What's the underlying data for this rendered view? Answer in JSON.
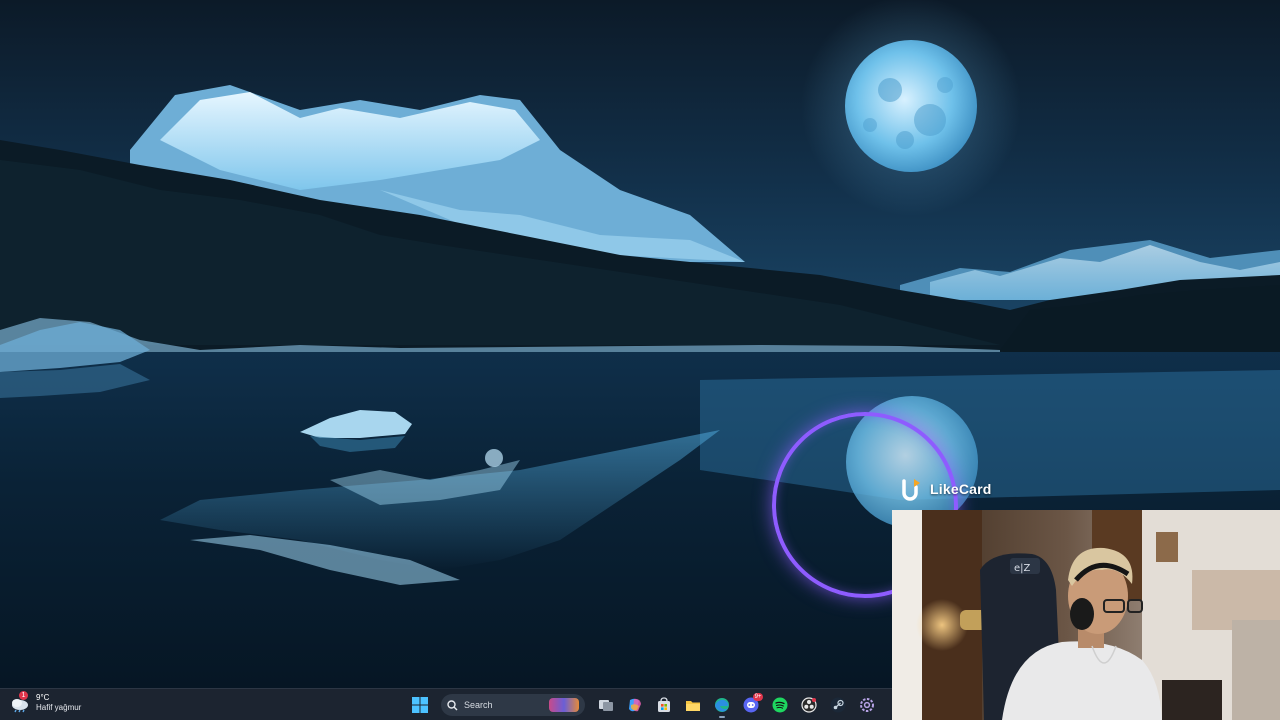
{
  "desktop": {
    "wallpaper_name": "moonlit-mountain-lake-wallpaper"
  },
  "overlay": {
    "brand": "LikeCard",
    "ring_color": "#8e5cff"
  },
  "taskbar": {
    "weather": {
      "temperature": "9°C",
      "condition": "Hafif yağmur",
      "badge": "1"
    },
    "search_label": "Search",
    "apps": [
      {
        "name": "start-button",
        "icon": "windows-logo-icon"
      },
      {
        "name": "task-view-button",
        "icon": "task-view-icon"
      },
      {
        "name": "copilot-button",
        "icon": "copilot-icon"
      },
      {
        "name": "microsoft-store-button",
        "icon": "store-icon"
      },
      {
        "name": "file-explorer-button",
        "icon": "folder-icon"
      },
      {
        "name": "edge-button",
        "icon": "edge-icon"
      },
      {
        "name": "discord-button",
        "icon": "discord-icon",
        "badge": "9+"
      },
      {
        "name": "spotify-button",
        "icon": "spotify-icon"
      },
      {
        "name": "obs-button",
        "icon": "obs-icon"
      },
      {
        "name": "steam-button",
        "icon": "steam-icon"
      },
      {
        "name": "settings-button",
        "icon": "settings-icon"
      }
    ],
    "discord_badge": "9+"
  }
}
